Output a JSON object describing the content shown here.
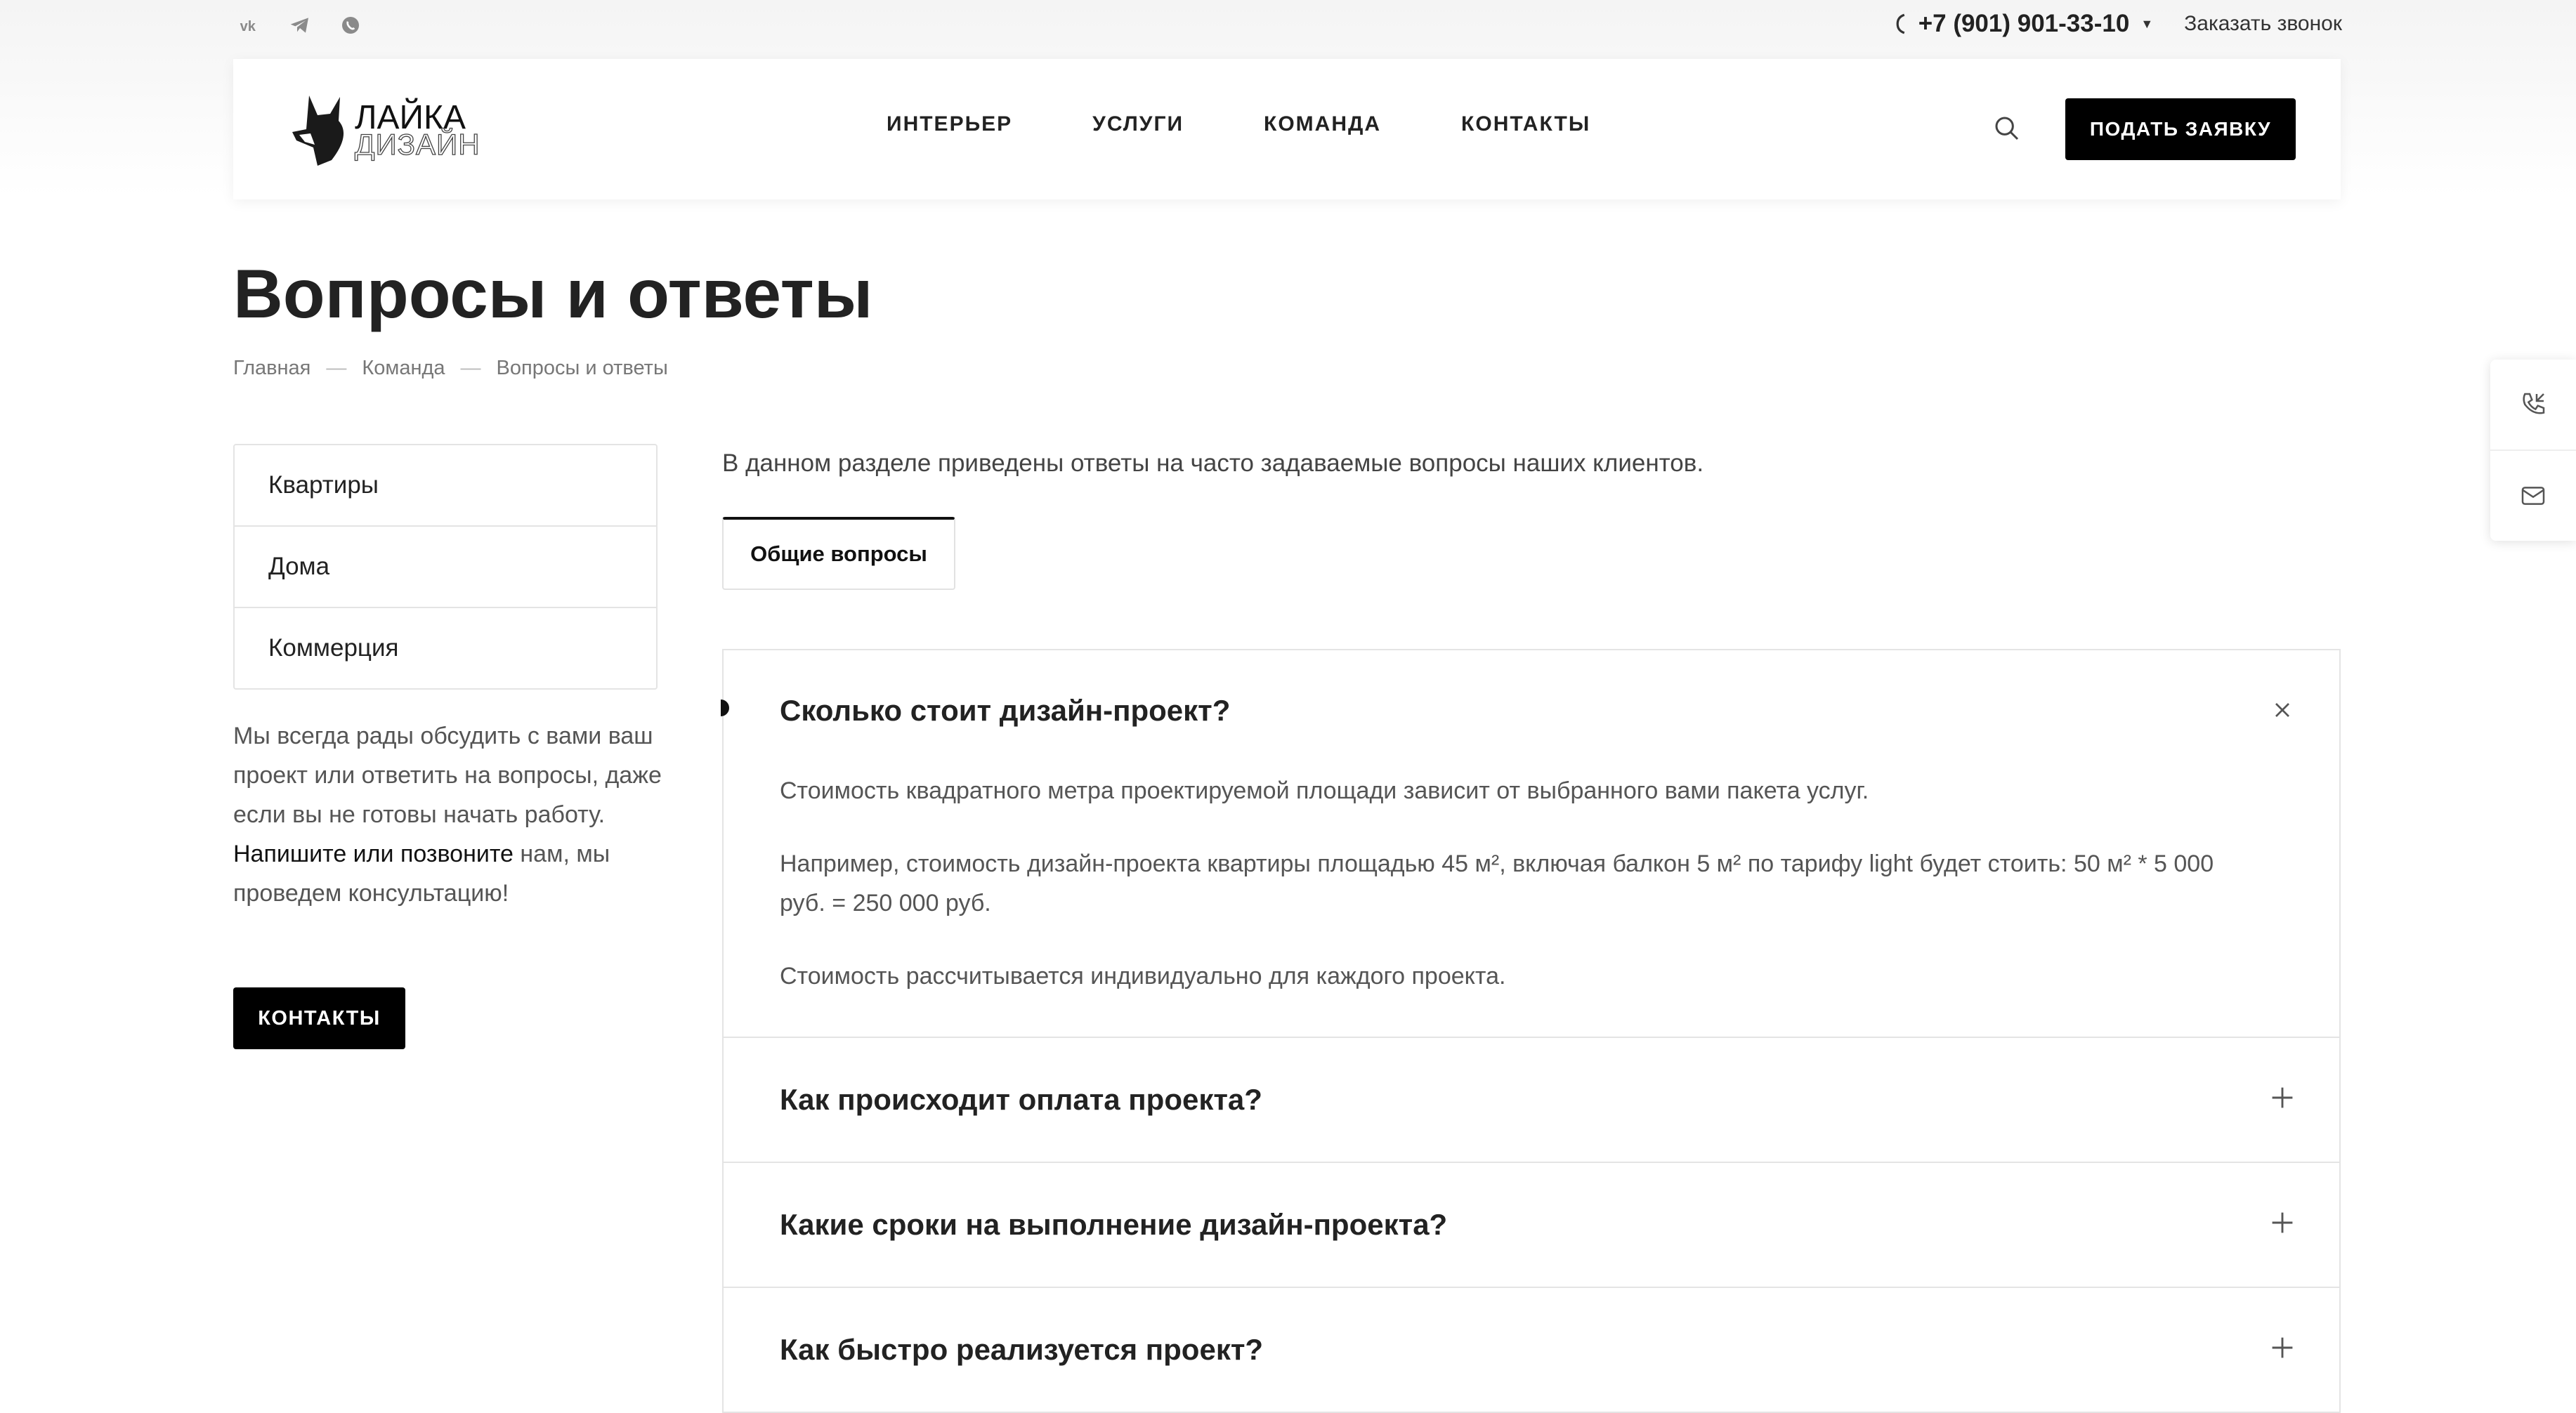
{
  "topbar": {
    "social": [
      "vk-icon",
      "telegram-icon",
      "whatsapp-icon"
    ],
    "phone": "+7 (901) 901-33-10",
    "callback_label": "Заказать звонок"
  },
  "header": {
    "logo_line1": "ЛАЙКА",
    "logo_line2": "ДИЗАЙН",
    "nav": [
      "ИНТЕРЬЕР",
      "УСЛУГИ",
      "КОМАНДА",
      "КОНТАКТЫ"
    ],
    "apply_label": "ПОДАТЬ ЗАЯВКУ"
  },
  "page": {
    "title": "Вопросы и ответы",
    "breadcrumbs": [
      "Главная",
      "Команда",
      "Вопросы и ответы"
    ]
  },
  "sidebar": {
    "items": [
      "Квартиры",
      "Дома",
      "Коммерция"
    ],
    "text_before": "Мы всегда рады обсудить с вами ваш проект или ответить на вопросы, даже если вы не готовы начать работу. ",
    "link_text": "Напишите или позвоните",
    "text_after": " нам, мы проведем консультацию!",
    "contacts_label": "КОНТАКТЫ"
  },
  "main": {
    "intro": "В данном разделе приведены ответы на часто задаваемые вопросы наших клиентов.",
    "tab_label": "Общие вопросы",
    "faq": [
      {
        "question": "Сколько стоит дизайн-проект?",
        "open": true,
        "answer": [
          "Стоимость квадратного метра проектируемой площади зависит от выбранного вами пакета услуг.",
          "Например, стоимость дизайн-проекта квартиры площадью 45 м², включая балкон 5 м² по тарифу light будет стоить: 50 м² * 5 000 руб. = 250 000 руб.",
          "Стоимость рассчитывается индивидуально для каждого проекта."
        ]
      },
      {
        "question": "Как происходит оплата проекта?",
        "open": false
      },
      {
        "question": "Какие сроки на выполнение дизайн-проекта?",
        "open": false
      },
      {
        "question": "Как быстро реализуется проект?",
        "open": false
      }
    ]
  },
  "colors": {
    "accent": "#000000",
    "text": "#222222",
    "muted": "#777777",
    "border": "#e4e4e4"
  }
}
